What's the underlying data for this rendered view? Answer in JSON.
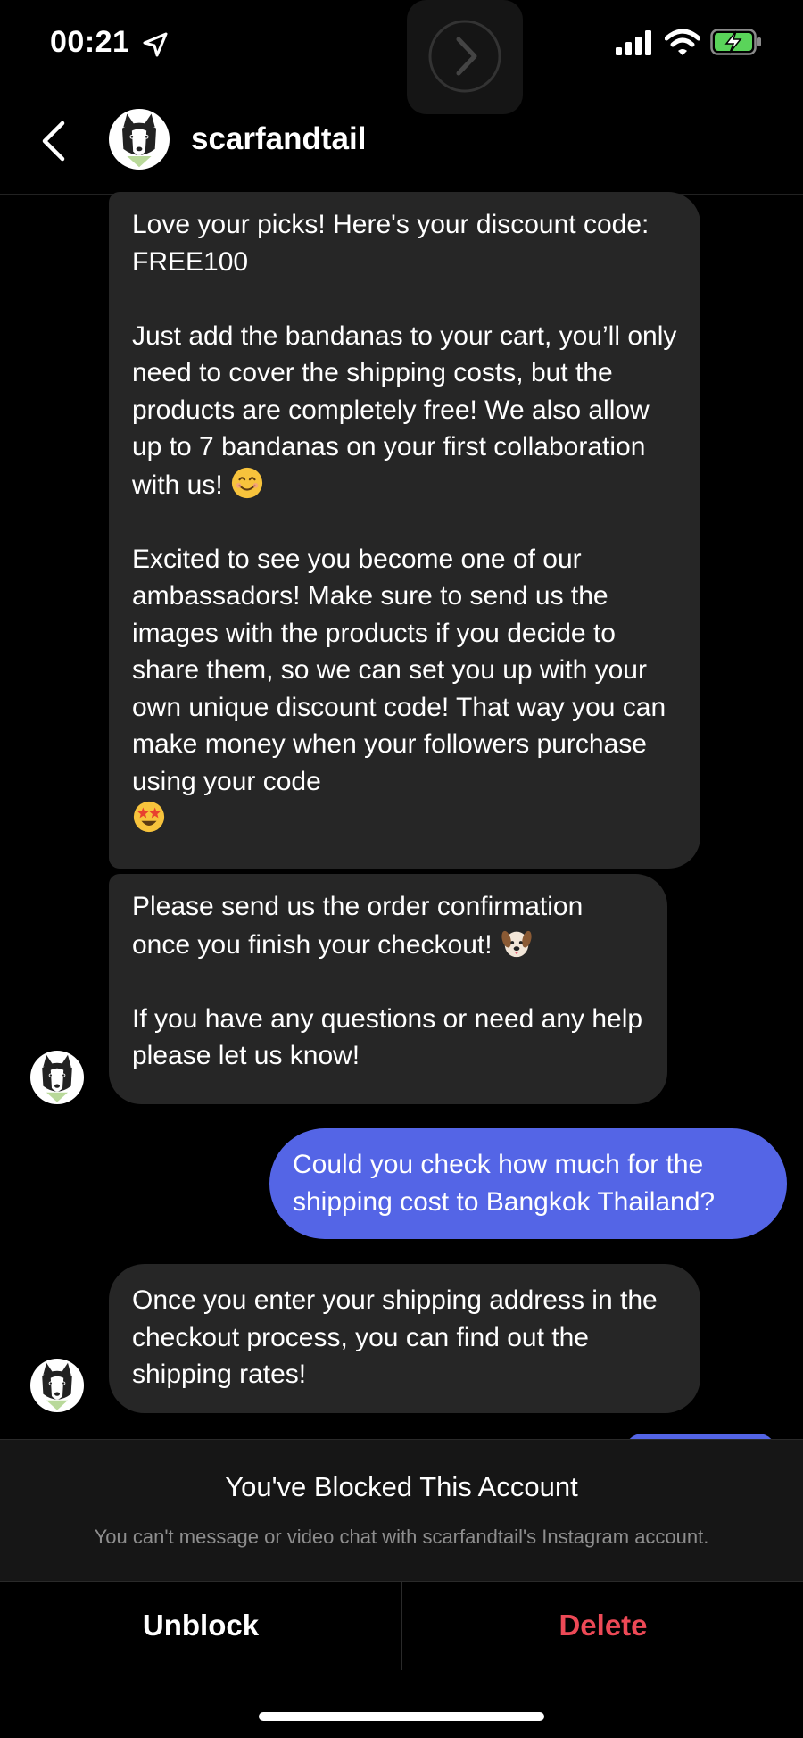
{
  "status_bar": {
    "time": "00:21",
    "icons": [
      "location-arrow-icon",
      "screen-recording-icon",
      "cellular-signal-icon",
      "wifi-icon",
      "battery-charging-icon"
    ]
  },
  "header": {
    "username": "scarfandtail",
    "back_icon": "chevron-left-icon",
    "avatar": "husky-dog-avatar"
  },
  "messages": [
    {
      "sender": "scarfandtail",
      "direction": "incoming",
      "paragraphs": [
        "Love your picks! Here's your discount code: FREE100",
        "Just add the bandanas to your cart, you’ll only need to cover the shipping costs, but the products are completely free! We also allow up to 7 bandanas on your first collaboration with us!",
        "Excited to see you become one of our ambassadors! Make sure to send us the images with the products if you decide to share them, so we can set you up with your own unique discount code! That way you can make money when your followers purchase using your code"
      ],
      "emojis": [
        "smiling-face-emoji",
        "star-struck-emoji"
      ]
    },
    {
      "sender": "scarfandtail",
      "direction": "incoming",
      "paragraphs": [
        "Please send us the order confirmation once you finish your checkout!",
        "If you have any questions or need any help please let us know!"
      ],
      "emojis": [
        "dog-face-emoji"
      ]
    },
    {
      "sender": "me",
      "direction": "outgoing",
      "paragraphs": [
        "Could you check how much for the shipping cost to Bangkok Thailand?"
      ]
    },
    {
      "sender": "scarfandtail",
      "direction": "incoming",
      "paragraphs": [
        "Once you enter your shipping address in the checkout process, you can find out the shipping rates!"
      ]
    }
  ],
  "blocked": {
    "title": "You've Blocked This Account",
    "subtitle": "You can't message or video chat with scarfandtail's Instagram account."
  },
  "actions": {
    "unblock_label": "Unblock",
    "delete_label": "Delete"
  },
  "colors": {
    "background": "#000000",
    "incoming_bubble": "#262626",
    "outgoing_bubble": "#5465e6",
    "delete_red": "#ed4956",
    "muted_text": "#8e8e8e"
  }
}
